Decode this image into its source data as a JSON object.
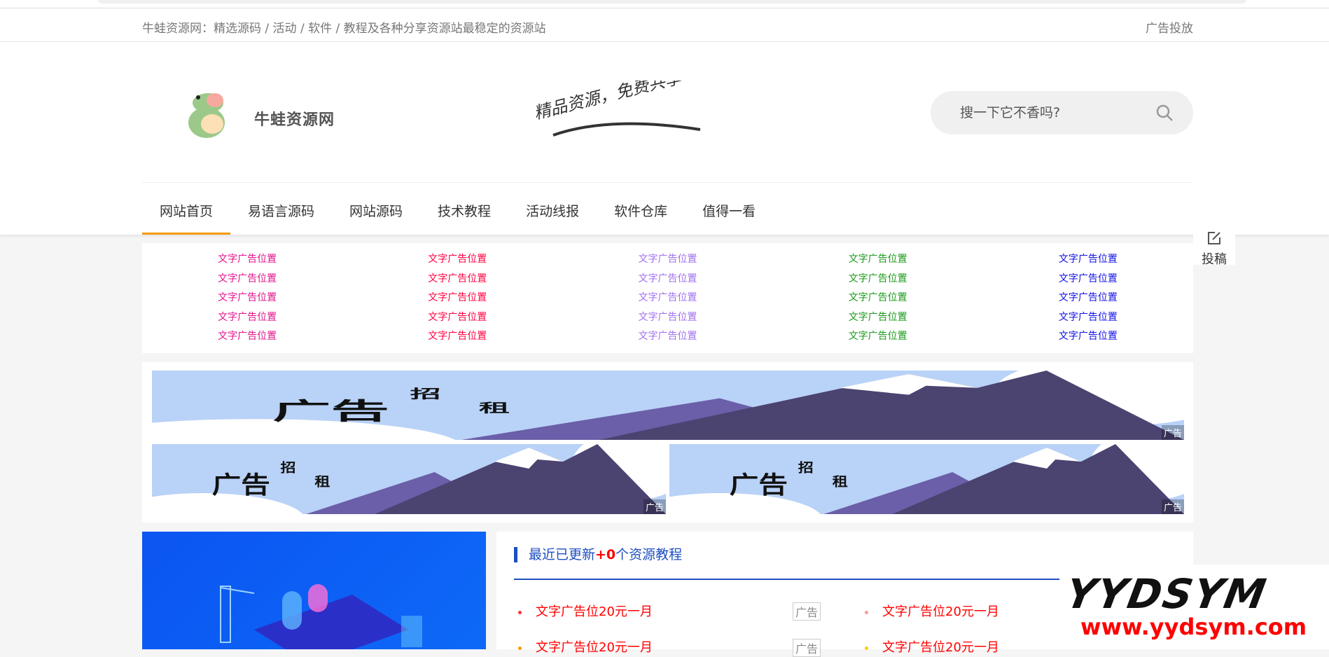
{
  "topbar": {
    "tagline": "牛蛙资源网：精选源码 / 活动 / 软件 / 教程及各种分享资源站最稳定的资源站",
    "ad_link": "广告投放"
  },
  "header": {
    "logo_text": "牛蛙资源网",
    "slogan": "精品资源，免费共享",
    "search_placeholder": "搜一下它不香吗?"
  },
  "nav": [
    {
      "label": "网站首页"
    },
    {
      "label": "易语言源码"
    },
    {
      "label": "网站源码"
    },
    {
      "label": "技术教程"
    },
    {
      "label": "活动线报"
    },
    {
      "label": "软件仓库"
    },
    {
      "label": "值得一看"
    }
  ],
  "float": {
    "submit_label": "投稿"
  },
  "text_ads": {
    "label": "文字广告位置",
    "colors": [
      "#e0148c",
      "#ff0040",
      "#a070f0",
      "#1a9a1a",
      "#1010e8"
    ],
    "rows": 5
  },
  "banners": {
    "word1": "广告",
    "word2": "招",
    "word3": "租",
    "tag": "广告"
  },
  "panel": {
    "title_prefix": "最近已更新",
    "count": "+0",
    "title_suffix": "个资源教程",
    "items": [
      {
        "text": "文字广告位20元一月",
        "dot": "#f33"
      },
      {
        "text": "文字广告位20元一月",
        "dot": "#f99"
      },
      {
        "text": "文字广告位20元一月",
        "dot": "#f90"
      },
      {
        "text": "文字广告位20元一月",
        "dot": "#fc0"
      }
    ],
    "ad_tag": "广告"
  },
  "watermark": {
    "brand": "YYDSYM",
    "url": "www.yydsym.com"
  }
}
